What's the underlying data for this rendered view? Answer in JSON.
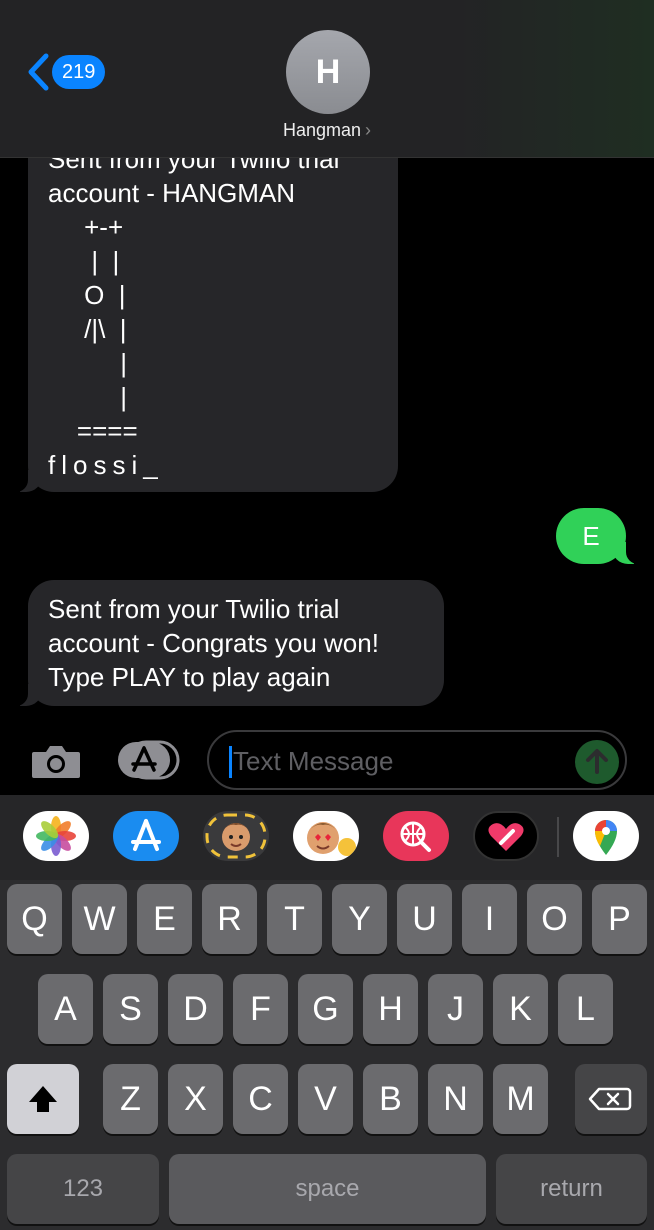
{
  "header": {
    "back_count": "219",
    "avatar_initial": "H",
    "contact_name": "Hangman",
    "chevron": "›"
  },
  "messages": {
    "hangman_board": {
      "lines": [
        "Sent from your Twilio trial",
        "account - HANGMAN",
        "     +-+",
        "      |  |",
        "     O  |",
        "     /|\\  |",
        "          |",
        "          |",
        "    ====",
        "flossi_"
      ]
    },
    "sent_guess": "E",
    "win_message": {
      "lines": [
        "Sent from your Twilio trial",
        "account - Congrats you won!",
        "Type PLAY to play again"
      ]
    }
  },
  "input": {
    "placeholder": "Text Message"
  },
  "app_strip": [
    {
      "name": "photos-app-icon"
    },
    {
      "name": "app-store-icon"
    },
    {
      "name": "memoji-stickers-icon"
    },
    {
      "name": "animoji-icon"
    },
    {
      "name": "web-search-icon"
    },
    {
      "name": "digital-touch-icon"
    },
    {
      "name": "google-maps-icon"
    }
  ],
  "keyboard": {
    "row1": [
      "Q",
      "W",
      "E",
      "R",
      "T",
      "Y",
      "U",
      "I",
      "O",
      "P"
    ],
    "row2": [
      "A",
      "S",
      "D",
      "F",
      "G",
      "H",
      "J",
      "K",
      "L"
    ],
    "row3": [
      "Z",
      "X",
      "C",
      "V",
      "B",
      "N",
      "M"
    ],
    "numbers_label": "123",
    "space_label": "space",
    "return_label": "return"
  },
  "colors": {
    "accent": "#0a84ff",
    "sent_bubble": "#30d158",
    "received_bubble": "#262629"
  }
}
